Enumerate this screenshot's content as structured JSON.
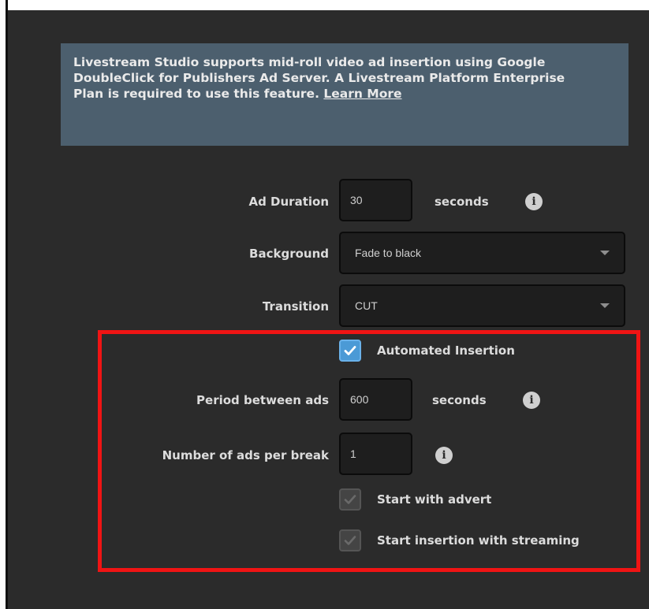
{
  "notice": {
    "text": "Livestream Studio supports mid-roll video ad insertion using Google DoubleClick for Publishers Ad Server. A Livestream Platform Enterprise Plan is required to use this feature.",
    "link_label": "Learn More"
  },
  "ad_duration": {
    "label": "Ad Duration",
    "value": "30",
    "unit": "seconds"
  },
  "background": {
    "label": "Background",
    "selected": "Fade to black"
  },
  "transition": {
    "label": "Transition",
    "selected": "CUT"
  },
  "automated_insertion": {
    "label": "Automated Insertion",
    "checked": true
  },
  "period_between_ads": {
    "label": "Period between ads",
    "value": "600",
    "unit": "seconds"
  },
  "ads_per_break": {
    "label": "Number of ads per break",
    "value": "1"
  },
  "start_with_advert": {
    "label": "Start with advert",
    "checked": true
  },
  "start_insertion_with_streaming": {
    "label": "Start insertion with streaming",
    "checked": true
  },
  "colors": {
    "panel_bg": "#2b2b2b",
    "notice_bg": "#4c5f6e",
    "checkbox_active": "#4b9ad6",
    "highlight_border": "#f01414"
  }
}
